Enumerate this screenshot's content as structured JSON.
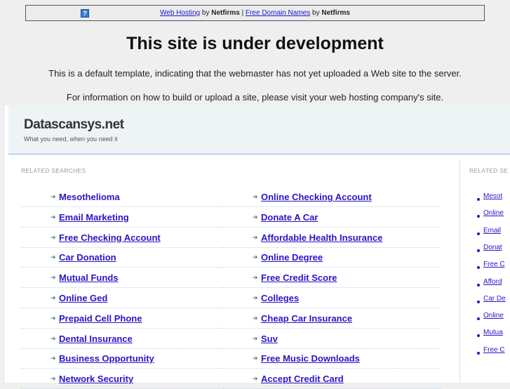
{
  "topbar": {
    "link1": "Web Hosting",
    "by1": " by ",
    "brand1": "Netfirms",
    "sep": " | ",
    "link2": "Free Domain Names",
    "by2": " by ",
    "brand2": "Netfirms"
  },
  "heading": "This site is under development",
  "para1": "This is a default template, indicating that the webmaster has not yet uploaded a Web site to the server.",
  "para2": "For information on how to build or upload a site, please visit your web hosting company's site.",
  "site": {
    "name": "Datascansys.net",
    "tagline": "What you need, when you need it"
  },
  "related_label": "RELATED SEARCHES",
  "related_label_side": "RELATED SE",
  "col1": [
    "Mesothelioma",
    "Email Marketing",
    "Free Checking Account",
    "Car Donation",
    "Mutual Funds",
    "Online Ged",
    "Prepaid Cell Phone",
    "Dental Insurance",
    "Business Opportunity",
    "Network Security"
  ],
  "col2": [
    "Online Checking Account",
    "Donate A Car",
    "Affordable Health Insurance",
    "Online Degree",
    "Free Credit Score",
    "Colleges",
    "Cheap Car Insurance",
    "Suv",
    "Free Music Downloads",
    "Accept Credit Card"
  ],
  "side": [
    "Mesot",
    "Online",
    "Email",
    "Donat",
    "Free C",
    "Afford",
    "Car De",
    "Online",
    "Mutua",
    "Free C"
  ]
}
